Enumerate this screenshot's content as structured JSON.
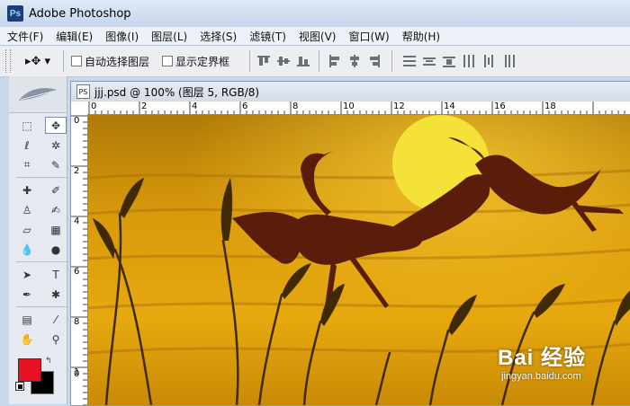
{
  "app": {
    "title": "Adobe Photoshop",
    "logo": "Ps"
  },
  "menu": [
    "文件(F)",
    "编辑(E)",
    "图像(I)",
    "图层(L)",
    "选择(S)",
    "滤镜(T)",
    "视图(V)",
    "窗口(W)",
    "帮助(H)"
  ],
  "options": {
    "tool_preset": "▸✥ ▾",
    "auto_select": {
      "label": "自动选择图层",
      "checked": false
    },
    "show_bounds": {
      "label": "显示定界框",
      "checked": false
    }
  },
  "document": {
    "title": "jjj.psd @ 100% (图层 5, RGB/8)",
    "icon": "PS",
    "ruler_h": [
      "0",
      "2",
      "4",
      "6",
      "8",
      "10",
      "12",
      "14",
      "16",
      "18"
    ],
    "ruler_v": [
      "0",
      "2",
      "4",
      "6",
      "8",
      "1",
      "0"
    ]
  },
  "colors": {
    "foreground": "#e81123",
    "background": "#000000"
  },
  "tools": [
    {
      "name": "marquee-tool",
      "glyph": "⬚"
    },
    {
      "name": "move-tool",
      "glyph": "✥",
      "active": true
    },
    {
      "name": "lasso-tool",
      "glyph": "ℓ"
    },
    {
      "name": "magic-wand-tool",
      "glyph": "✲"
    },
    {
      "name": "crop-tool",
      "glyph": "⌗"
    },
    {
      "name": "slice-tool",
      "glyph": "✎"
    },
    {
      "name": "healing-brush-tool",
      "glyph": "✚"
    },
    {
      "name": "brush-tool",
      "glyph": "✐"
    },
    {
      "name": "stamp-tool",
      "glyph": "♙"
    },
    {
      "name": "history-brush-tool",
      "glyph": "✍"
    },
    {
      "name": "eraser-tool",
      "glyph": "▱"
    },
    {
      "name": "gradient-tool",
      "glyph": "▦"
    },
    {
      "name": "blur-tool",
      "glyph": "💧"
    },
    {
      "name": "dodge-tool",
      "glyph": "●"
    },
    {
      "name": "path-selection-tool",
      "glyph": "➤"
    },
    {
      "name": "type-tool",
      "glyph": "T"
    },
    {
      "name": "pen-tool",
      "glyph": "✒"
    },
    {
      "name": "shape-tool",
      "glyph": "✱"
    },
    {
      "name": "notes-tool",
      "glyph": "▤"
    },
    {
      "name": "eyedropper-tool",
      "glyph": "⁄"
    },
    {
      "name": "hand-tool",
      "glyph": "✋"
    },
    {
      "name": "zoom-tool",
      "glyph": "⚲"
    }
  ],
  "watermark": {
    "main": "Bai   经验",
    "sub": "jingyan.baidu.com"
  }
}
